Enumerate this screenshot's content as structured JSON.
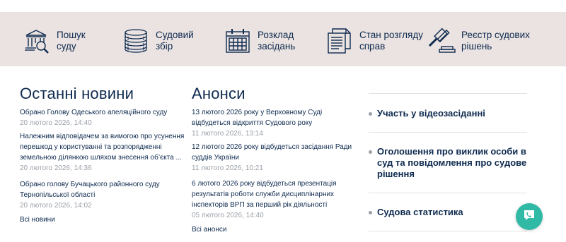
{
  "services": [
    {
      "icon": "court-building-magnifier-icon",
      "label": "Пошук\nсуду"
    },
    {
      "icon": "coin-stack-icon",
      "label": "Судовий\nзбір"
    },
    {
      "icon": "calendar-icon",
      "label": "Розклад\nзасідань"
    },
    {
      "icon": "documents-icon",
      "label": "Стан розгляду\nсправ"
    },
    {
      "icon": "gavel-icon",
      "label": "Реєстр судових\nрішень"
    }
  ],
  "news": {
    "title": "Останні новини",
    "items": [
      {
        "text": "Обрано Голову Одеського апеляційного суду",
        "date": "20 лютого 2026, 14:40"
      },
      {
        "text": "Належним відповідачем за вимогою про усунення перешкод у користуванні та розпорядженні земельною ділянкою шляхом знесення об’єкта ...",
        "date": "20 лютого 2026, 14:36"
      },
      {
        "text": "Обрано голову Бучацького районного суду Тернопільської області",
        "date": "20 лютого 2026, 14:02"
      }
    ],
    "all_link": "Всі новини"
  },
  "announcements": {
    "title": "Анонси",
    "items": [
      {
        "text": "13 лютого 2026 року у Верховному Суді відбудеться відкриття Судового року",
        "date": "11 лютого 2026, 13:14"
      },
      {
        "text": "12 лютого 2026 року відбудеться засідання Ради суддів України",
        "date": "11 лютого 2026, 10:21"
      },
      {
        "text": "6 лютого 2026 року відбудеться презентація результатів роботи служби дисциплінарних інспекторів ВРП за перший рік діяльності",
        "date": "05 лютого 2026, 14:40"
      }
    ],
    "all_link": "Всі анонси"
  },
  "side_links": [
    "Участь у відеозасіданні",
    "Оголошення про виклик особи в суд та повідомлення про судове рішення",
    "Судова статистика"
  ],
  "chat": {
    "icon": "chat-phone-icon"
  },
  "colors": {
    "band": "#eae3e1",
    "text": "#0e2a4f",
    "muted": "#9aa0a8",
    "accent": "#30b9a5"
  }
}
